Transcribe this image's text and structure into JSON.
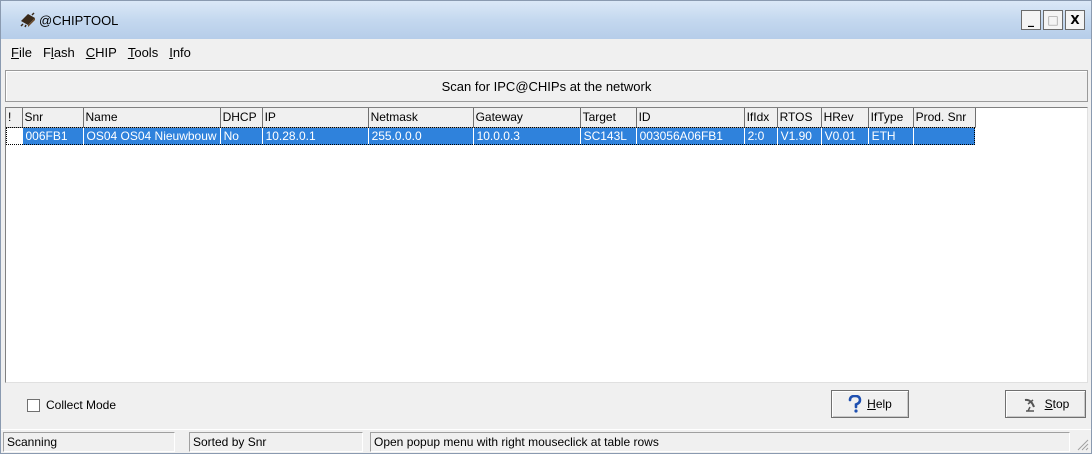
{
  "window": {
    "title": "@CHIPTOOL",
    "controls": {
      "minimize": "_",
      "maximize": "□",
      "close": "X"
    }
  },
  "menu": [
    {
      "accel": "F",
      "rest": "ile"
    },
    {
      "pre": "F",
      "accel": "l",
      "rest": "ash"
    },
    {
      "accel": "C",
      "rest": "HIP"
    },
    {
      "accel": "T",
      "rest": "ools"
    },
    {
      "accel": "I",
      "rest": "nfo"
    }
  ],
  "scan_button": "Scan for IPC@CHIPs at the network",
  "table": {
    "columns": [
      "!",
      "Snr",
      "Name",
      "DHCP",
      "IP",
      "Netmask",
      "Gateway",
      "Target",
      "ID",
      "IfIdx",
      "RTOS",
      "HRev",
      "IfType",
      "Prod. Snr"
    ],
    "rows": [
      [
        "",
        "006FB1",
        "OS04 OS04 Nieuwbouw",
        "No",
        "10.28.0.1",
        "255.0.0.0",
        "10.0.0.3",
        "SC143L",
        "003056A06FB1",
        "2:0",
        "V1.90",
        "V0.01",
        "ETH",
        ""
      ]
    ],
    "selected_row": 0,
    "selection_color": "#2f82dc"
  },
  "collect_mode": {
    "label": "Collect Mode",
    "checked": false
  },
  "buttons": {
    "help": {
      "accel": "H",
      "rest": "elp",
      "icon": "question-mark-icon"
    },
    "stop": {
      "accel": "S",
      "rest": "top",
      "icon": "satellite-dish-icon"
    }
  },
  "status": {
    "scanning": "Scanning",
    "sorted": "Sorted by Snr",
    "hint": "Open popup menu with right mouseclick at table rows"
  }
}
